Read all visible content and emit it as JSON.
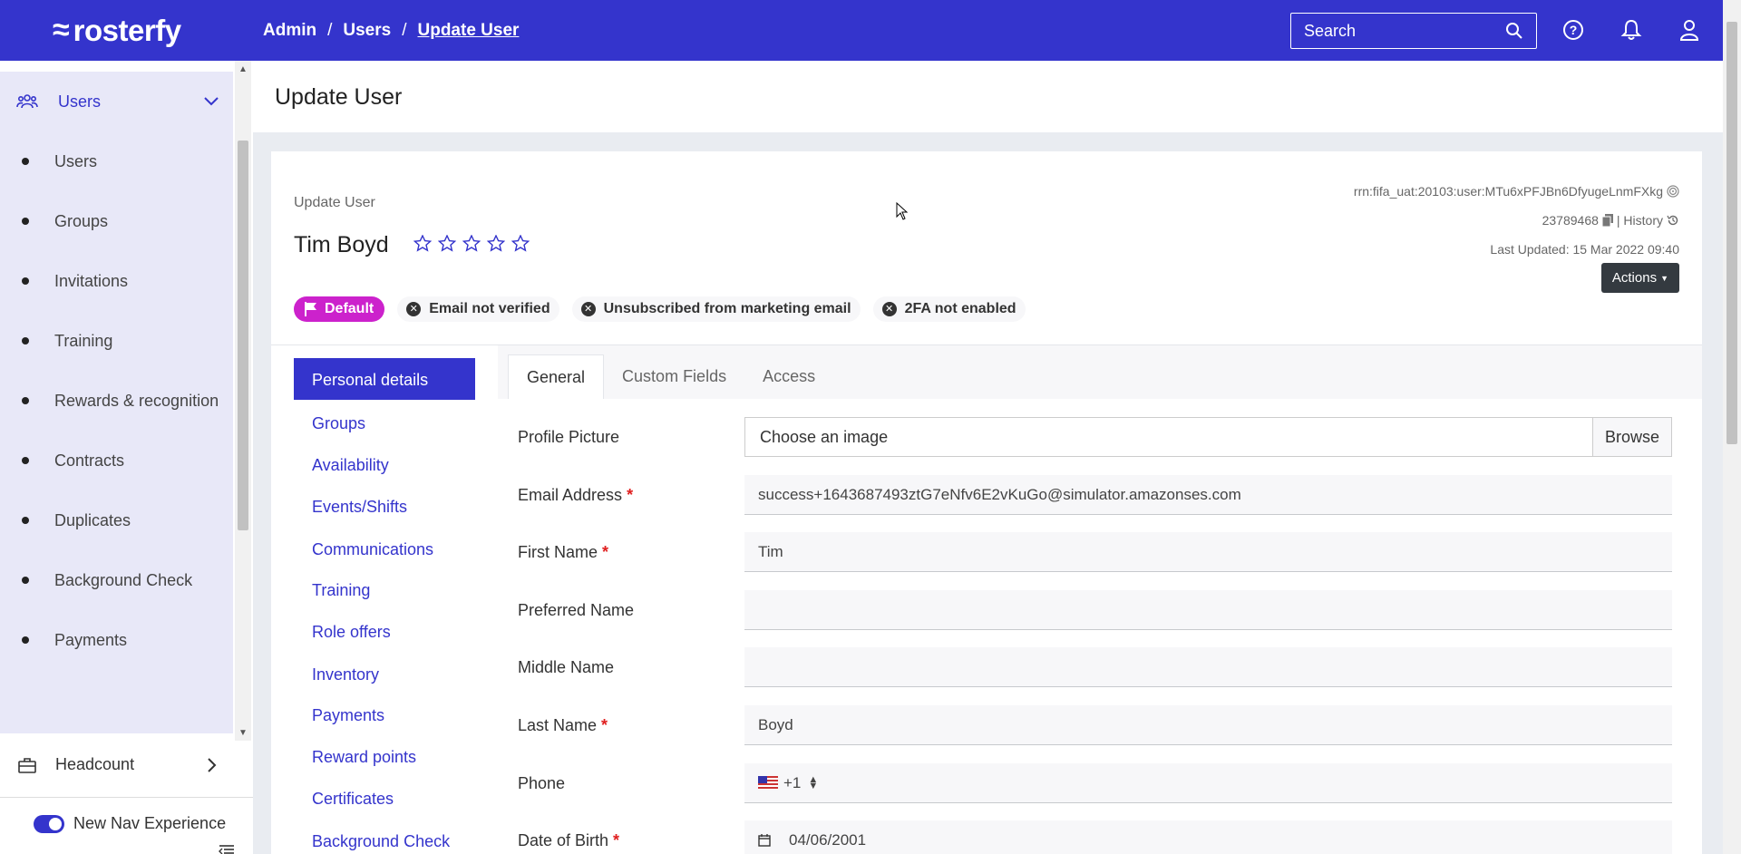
{
  "app": {
    "brand": "rosterfy"
  },
  "breadcrumb": [
    "Admin",
    "Users",
    "Update User"
  ],
  "search": {
    "placeholder": "Search"
  },
  "sidebar": {
    "section": "Users",
    "items": [
      "Users",
      "Groups",
      "Invitations",
      "Training",
      "Rewards & recognition",
      "Contracts",
      "Duplicates",
      "Background Check",
      "Payments"
    ],
    "headcount": "Headcount",
    "new_nav_label": "New Nav Experience",
    "new_nav_on": true
  },
  "page": {
    "title": "Update User"
  },
  "profile": {
    "subtitle": "Update User",
    "name": "Tim Boyd",
    "rating": 0,
    "rating_max": 5,
    "rrn": "rrn:fifa_uat:20103:user:MTu6xPFJBn6DfyugeLnmFXkg",
    "id": "23789468",
    "history_label": "| History",
    "last_updated": "Last Updated: 15 Mar 2022 09:40",
    "actions_label": "Actions"
  },
  "badges": {
    "default": "Default",
    "statuses": [
      "Email not verified",
      "Unsubscribed from marketing email",
      "2FA not enabled"
    ]
  },
  "subnav": {
    "active": "Personal details",
    "items": [
      "Groups",
      "Availability",
      "Events/Shifts",
      "Communications",
      "Training",
      "Role offers",
      "Inventory",
      "Payments",
      "Reward points",
      "Certificates",
      "Background Check"
    ]
  },
  "tabs": [
    "General",
    "Custom Fields",
    "Access"
  ],
  "form": {
    "profile_picture": {
      "label": "Profile Picture",
      "placeholder": "Choose an image",
      "browse": "Browse"
    },
    "email": {
      "label": "Email Address",
      "value": "success+1643687493ztG7eNfv6E2vKuGo@simulator.amazonses.com"
    },
    "first_name": {
      "label": "First Name",
      "value": "Tim"
    },
    "preferred_name": {
      "label": "Preferred Name",
      "value": ""
    },
    "middle_name": {
      "label": "Middle Name",
      "value": ""
    },
    "last_name": {
      "label": "Last Name",
      "value": "Boyd"
    },
    "phone": {
      "label": "Phone",
      "code": "+1",
      "value": ""
    },
    "dob": {
      "label": "Date of Birth",
      "value": "04/06/2001"
    }
  },
  "colors": {
    "primary": "#3434cc",
    "default_badge": "#cc22cc",
    "required": "#e02020"
  }
}
